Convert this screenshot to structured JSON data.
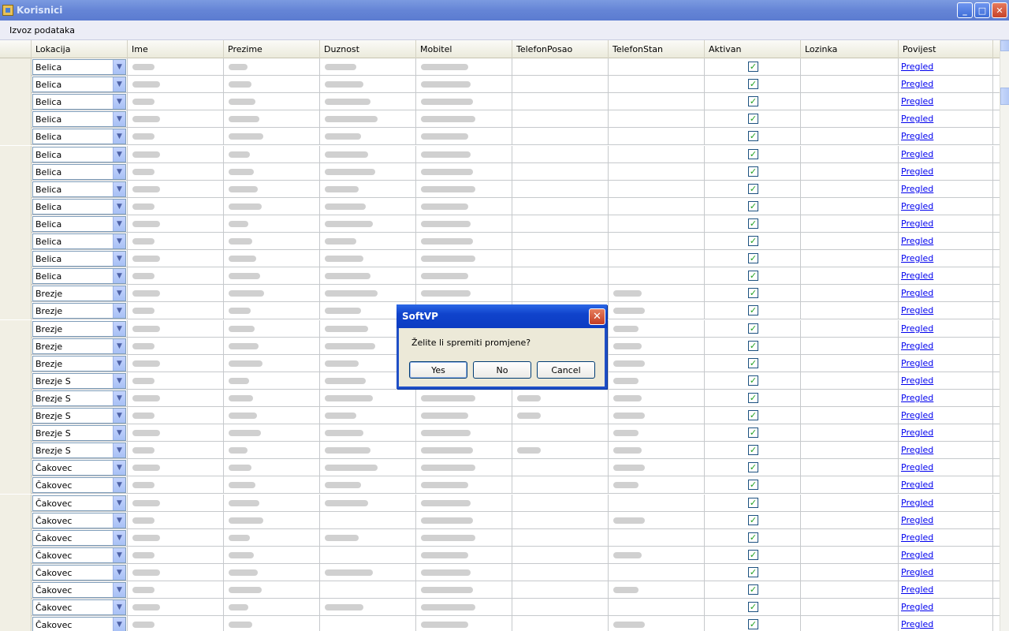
{
  "window": {
    "title": "Korisnici"
  },
  "menu": {
    "items": [
      "Izvoz podataka"
    ]
  },
  "grid": {
    "columns": [
      "Lokacija",
      "Ime",
      "Prezime",
      "Duznost",
      "Mobitel",
      "TelefonPosao",
      "TelefonStan",
      "Aktivan",
      "Lozinka",
      "Povijest"
    ],
    "link_label": "Pregled",
    "checkmark": "✓",
    "rows": [
      {
        "lokacija": "Belica",
        "aktivan": true
      },
      {
        "lokacija": "Belica",
        "aktivan": true
      },
      {
        "lokacija": "Belica",
        "aktivan": true
      },
      {
        "lokacija": "Belica",
        "aktivan": true
      },
      {
        "lokacija": "Belica",
        "aktivan": true
      },
      {
        "lokacija": "Belica",
        "aktivan": true
      },
      {
        "lokacija": "Belica",
        "aktivan": true
      },
      {
        "lokacija": "Belica",
        "aktivan": true
      },
      {
        "lokacija": "Belica",
        "aktivan": true
      },
      {
        "lokacija": "Belica",
        "aktivan": true
      },
      {
        "lokacija": "Belica",
        "aktivan": true
      },
      {
        "lokacija": "Belica",
        "aktivan": true
      },
      {
        "lokacija": "Belica",
        "aktivan": true
      },
      {
        "lokacija": "Brezje",
        "aktivan": true
      },
      {
        "lokacija": "Brezje",
        "aktivan": true
      },
      {
        "lokacija": "Brezje",
        "aktivan": true
      },
      {
        "lokacija": "Brezje",
        "aktivan": true
      },
      {
        "lokacija": "Brezje",
        "aktivan": true
      },
      {
        "lokacija": "Brezje S",
        "aktivan": true
      },
      {
        "lokacija": "Brezje S",
        "aktivan": true
      },
      {
        "lokacija": "Brezje S",
        "aktivan": true
      },
      {
        "lokacija": "Brezje S",
        "aktivan": true
      },
      {
        "lokacija": "Brezje S",
        "aktivan": true
      },
      {
        "lokacija": "Čakovec",
        "aktivan": true
      },
      {
        "lokacija": "Čakovec",
        "aktivan": true
      },
      {
        "lokacija": "Čakovec",
        "aktivan": true
      },
      {
        "lokacija": "Čakovec",
        "aktivan": true
      },
      {
        "lokacija": "Čakovec",
        "aktivan": true
      },
      {
        "lokacija": "Čakovec",
        "aktivan": true
      },
      {
        "lokacija": "Čakovec",
        "aktivan": true
      },
      {
        "lokacija": "Čakovec",
        "aktivan": true
      },
      {
        "lokacija": "Čakovec",
        "aktivan": true
      },
      {
        "lokacija": "Čakovec",
        "aktivan": true
      }
    ]
  },
  "dialog": {
    "title": "SoftVP",
    "message": "Želite li spremiti promjene?",
    "buttons": [
      "Yes",
      "No",
      "Cancel"
    ],
    "close_glyph": "✕"
  },
  "icons": {
    "window_controls": [
      "minimize-icon",
      "maximize-icon",
      "close-icon"
    ],
    "dropdown": "chevron-down-icon"
  }
}
